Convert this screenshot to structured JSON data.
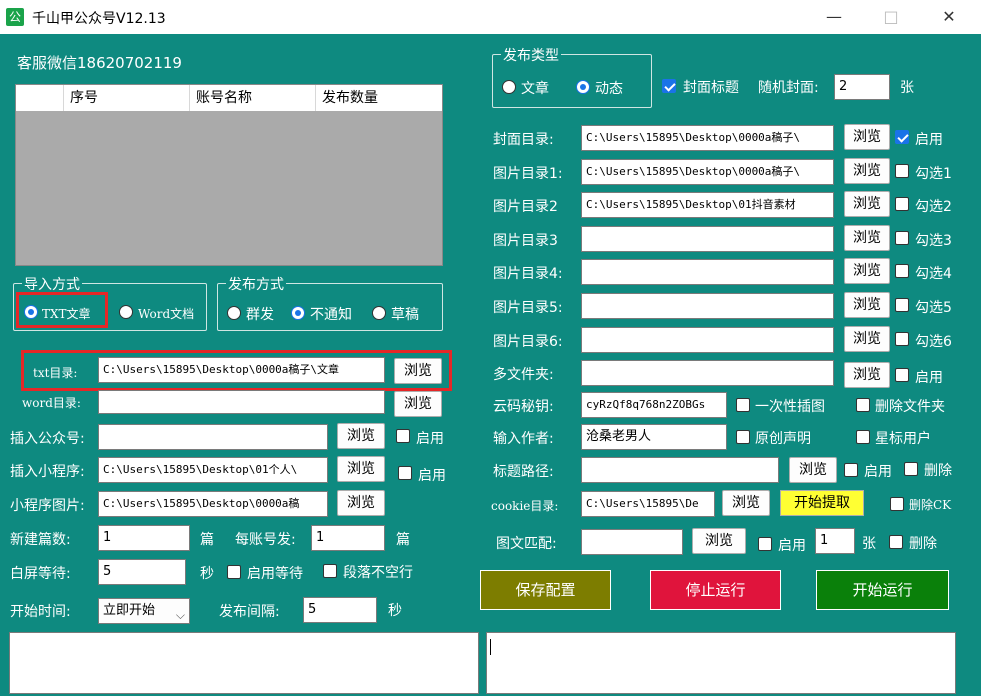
{
  "window": {
    "title": "千山甲公众号V12.13",
    "app_icon": "公",
    "minimize": "—",
    "maximize": "□",
    "close": "✕"
  },
  "service": "客服微信18620702119",
  "list": {
    "headers": [
      "",
      "序号",
      "账号名称",
      "发布数量"
    ]
  },
  "import": {
    "label": "导入方式",
    "options": [
      "TXT文章",
      "Word文档"
    ],
    "selected": 0
  },
  "publish_mode": {
    "label": "发布方式",
    "options": [
      "群发",
      "不通知",
      "草稿"
    ],
    "selected": 1
  },
  "publish_type": {
    "label": "发布类型",
    "options": [
      "文章",
      "动态"
    ],
    "selected": 1
  },
  "cover_title": {
    "label": "封面标题",
    "checked": true
  },
  "random_cover": {
    "label": "随机封面:",
    "value": "2",
    "unit": "张"
  },
  "left_fields": {
    "txt_dir": {
      "label": "txt目录:",
      "value": "C:\\Users\\15895\\Desktop\\0000a稿子\\文章",
      "browse": "浏览"
    },
    "word_dir": {
      "label": "word目录:",
      "value": "",
      "browse": "浏览"
    },
    "insert_account": {
      "label": "插入公众号:",
      "value": "",
      "browse": "浏览",
      "enable": "启用",
      "checked": false
    },
    "insert_mini": {
      "label": "插入小程序:",
      "value": "C:\\Users\\15895\\Desktop\\01个人\\",
      "browse": "浏览",
      "enable": "启用",
      "checked": false
    },
    "mini_image": {
      "label": "小程序图片:",
      "value": "C:\\Users\\15895\\Desktop\\0000a稿",
      "browse": "浏览"
    },
    "new_count": {
      "label": "新建篇数:",
      "value": "1",
      "unit": "篇"
    },
    "per_account": {
      "label": "每账号发:",
      "value": "1",
      "unit": "篇"
    },
    "white_wait": {
      "label": "白屏等待:",
      "value": "5",
      "unit": "秒"
    },
    "enable_wait": {
      "label": "启用等待",
      "checked": false
    },
    "no_blank": {
      "label": "段落不空行",
      "checked": false
    },
    "start_time": {
      "label": "开始时间:",
      "value": "立即开始",
      "arrow": "⌵"
    },
    "interval": {
      "label": "发布间隔:",
      "value": "5",
      "unit": "秒"
    }
  },
  "right_fields": {
    "cover_dir": {
      "label": "封面目录:",
      "value": "C:\\Users\\15895\\Desktop\\0000a稿子\\",
      "browse": "浏览",
      "check": "启用",
      "checked": true
    },
    "img1": {
      "label": "图片目录1:",
      "value": "C:\\Users\\15895\\Desktop\\0000a稿子\\",
      "browse": "浏览",
      "check": "勾选1",
      "checked": false
    },
    "img2": {
      "label": "图片目录2",
      "value": "C:\\Users\\15895\\Desktop\\01抖音素材",
      "browse": "浏览",
      "check": "勾选2",
      "checked": false
    },
    "img3": {
      "label": "图片目录3",
      "value": "",
      "browse": "浏览",
      "check": "勾选3",
      "checked": false
    },
    "img4": {
      "label": "图片目录4:",
      "value": "",
      "browse": "浏览",
      "check": "勾选4",
      "checked": false
    },
    "img5": {
      "label": "图片目录5:",
      "value": "",
      "browse": "浏览",
      "check": "勾选5",
      "checked": false
    },
    "img6": {
      "label": "图片目录6:",
      "value": "",
      "browse": "浏览",
      "check": "勾选6",
      "checked": false
    },
    "multi_folder": {
      "label": "多文件夹:",
      "value": "",
      "browse": "浏览",
      "check": "启用",
      "checked": false
    },
    "cloud_key": {
      "label": "云码秘钥:",
      "value": "cyRzQf8q768n2ZOBGs",
      "check1": "一次性插图",
      "check2": "删除文件夹"
    },
    "author": {
      "label": "输入作者:",
      "value": "沧桑老男人",
      "check1": "原创声明",
      "check2": "星标用户"
    },
    "title_path": {
      "label": "标题路径:",
      "value": "",
      "browse": "浏览",
      "check1": "启用",
      "check2": "删除"
    },
    "cookie_dir": {
      "label": "cookie目录:",
      "value": "C:\\Users\\15895\\De",
      "browse": "浏览",
      "extract": "开始提取",
      "check": "删除CK"
    },
    "match": {
      "label": "图文匹配:",
      "value": "",
      "browse": "浏览",
      "check1": "启用",
      "num": "1",
      "unit": "张",
      "check2": "删除"
    }
  },
  "actions": {
    "save": {
      "label": "保存配置",
      "color": "#7d7d00"
    },
    "stop": {
      "label": "停止运行",
      "color": "#e0143c"
    },
    "start": {
      "label": "开始运行",
      "color": "#0a800a"
    }
  }
}
